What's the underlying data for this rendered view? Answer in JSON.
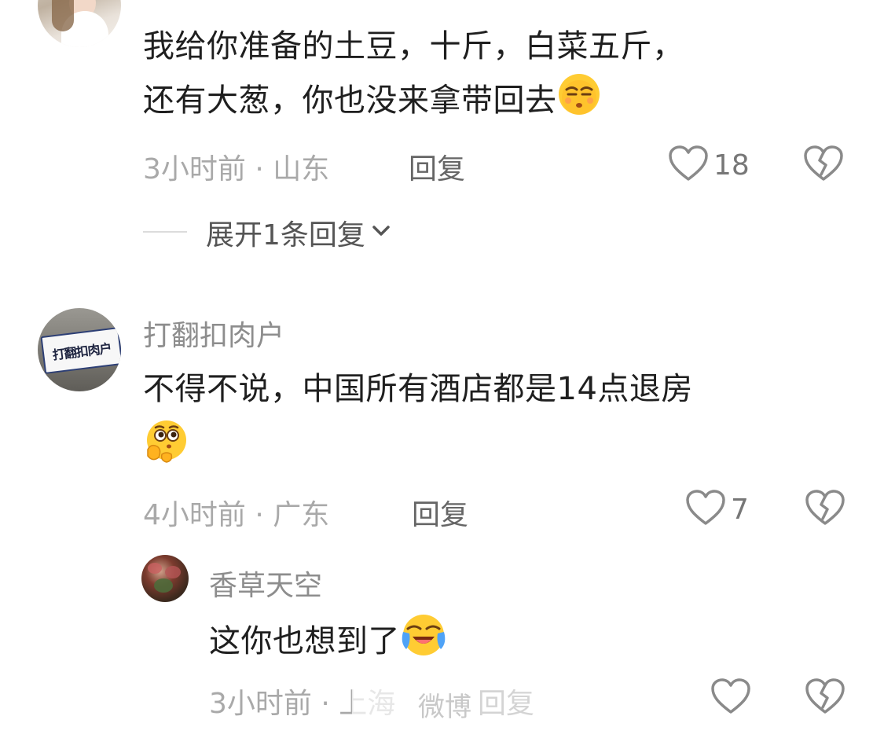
{
  "comments": [
    {
      "text_line1": "我给你准备的土豆，十斤，白菜五斤，",
      "text_line2": "还有大葱，你也没来拿带回去",
      "emoji": "smirk-face",
      "time_location": "3小时前 · 山东",
      "reply_label": "回复",
      "likes": "18",
      "expand_label": "展开1条回复"
    },
    {
      "username": "打翻扣肉户",
      "avatar_sign_text": "打翻扣肉户",
      "text_line1": "不得不说，中国所有酒店都是14点退房",
      "emoji": "thinking-hugging-face",
      "time_location": "4小时前 · 广东",
      "reply_label": "回复",
      "likes": "7"
    },
    {
      "username": "香草天空",
      "text_line1": "这你也想到了",
      "emoji": "laughing-crying-face",
      "time_location": "3小时前 · 上海",
      "reply_label": "回复",
      "likes": ""
    }
  ],
  "watermark": "微博",
  "colors": {
    "meta": "#a9a9a9",
    "text": "#1f1f1f",
    "icon": "#8a8a8a"
  }
}
